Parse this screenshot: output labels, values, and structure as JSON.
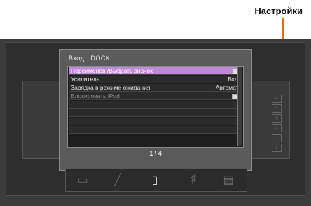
{
  "callout": {
    "label": "Настройки"
  },
  "dialog": {
    "title": "Вход : DOCK",
    "menu_items": [
      {
        "label": "Переименов./Выбрать значок",
        "value": "",
        "icon": "folder-icon",
        "state": "selected"
      },
      {
        "label": "Усилитель",
        "value": "Вкл.",
        "icon": "",
        "state": "normal"
      },
      {
        "label": "Зарядка в режиме ожидания",
        "value": "Автомат.",
        "icon": "",
        "state": "normal"
      },
      {
        "label": "Блокировать iPod",
        "value": "",
        "icon": "folder-icon",
        "state": "disabled"
      }
    ],
    "page": "1 / 4"
  },
  "bottom_bar": {
    "icons": [
      "receiver-icon",
      "cable-icon",
      "ipod-dock-icon",
      "speaker-icon",
      "tuner-icon"
    ]
  },
  "colors": {
    "accent": "#e06c10",
    "selected": "#c088d8"
  }
}
